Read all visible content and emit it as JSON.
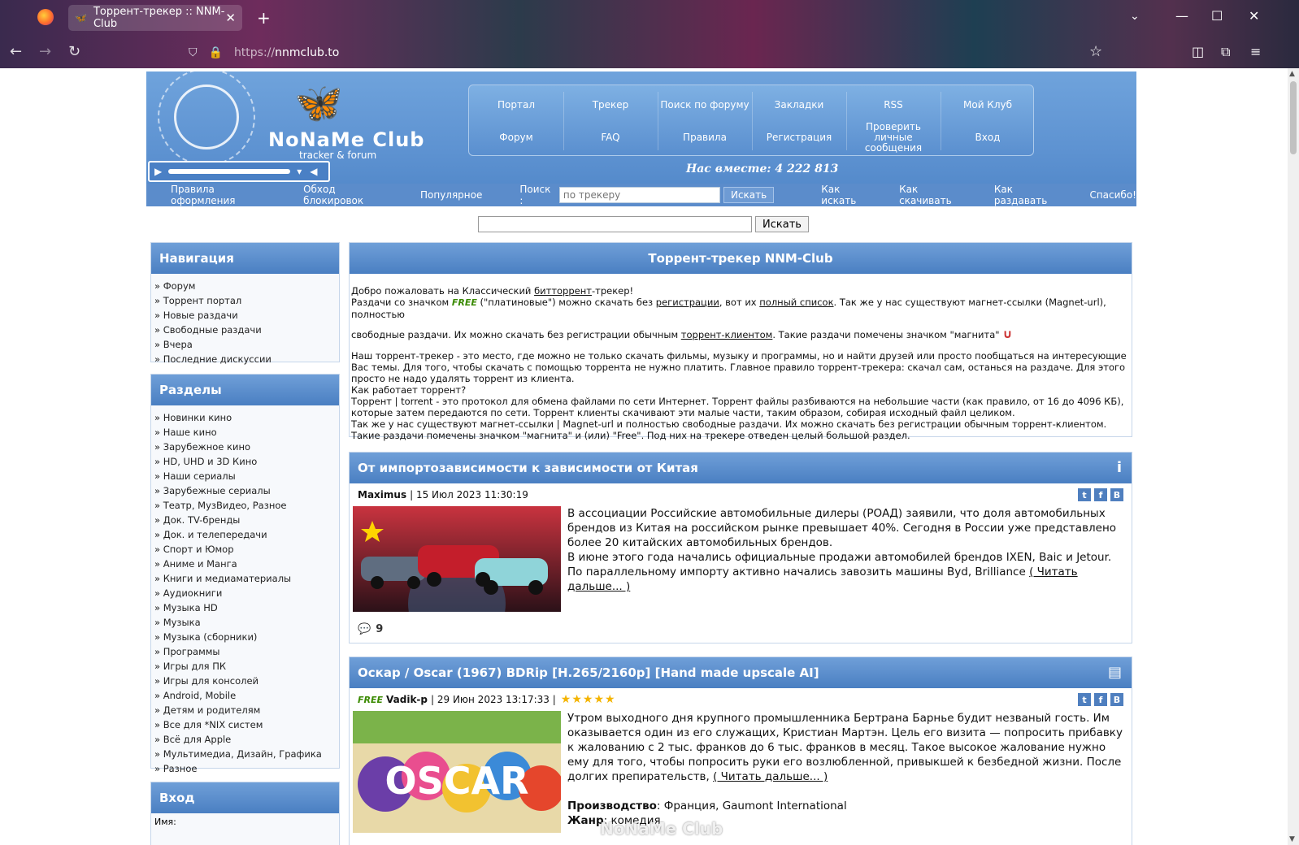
{
  "browser": {
    "tab_title": "Торрент-трекер :: NNM-Club",
    "url_scheme": "https://",
    "url_host": "nnmclub.to"
  },
  "header": {
    "logo_title": "NoNaMe Club",
    "logo_sub": "tracker & forum",
    "together": "Нас вместе: 4 222 813",
    "menu": [
      "Портал",
      "Трекер",
      "Поиск по форуму",
      "Закладки",
      "RSS",
      "Мой Клуб",
      "Форум",
      "FAQ",
      "Правила",
      "Регистрация",
      "Проверить личные сообщения",
      "Вход"
    ]
  },
  "subbar": {
    "left_links": [
      "Правила оформления",
      "Обход блокировок",
      "Популярное"
    ],
    "search_label": "Поиск :",
    "search_placeholder": "по трекеру",
    "search_button": "Искать",
    "right_links": [
      "Как искать",
      "Как скачивать",
      "Как раздавать",
      "Спасибо!"
    ]
  },
  "global_search": {
    "button": "Искать"
  },
  "sidebar": {
    "nav": {
      "title": "Навигация",
      "items": [
        "Форум",
        "Торрент портал",
        "Новые раздачи",
        "Свободные раздачи",
        "Вчера",
        "Последние дискуссии"
      ]
    },
    "sections": {
      "title": "Разделы",
      "items": [
        "Новинки кино",
        "Наше кино",
        "Зарубежное кино",
        "HD, UHD и 3D Кино",
        "Наши сериалы",
        "Зарубежные сериалы",
        "Театр, МузВидео, Разное",
        "Док. TV-бренды",
        "Док. и телепередачи",
        "Спорт и Юмор",
        "Аниме и Манга",
        "Книги и медиаматериалы",
        "Аудиокниги",
        "Музыка HD",
        "Музыка",
        "Музыка (сборники)",
        "Программы",
        "Игры для ПК",
        "Игры для консолей",
        "Android, Mobile",
        "Детям и родителям",
        "Все для *NIX систем",
        "Всё для Apple",
        "Мультимедиа, Дизайн, Графика",
        "Разное"
      ]
    },
    "login": {
      "title": "Вход",
      "name_label": "Имя:"
    }
  },
  "welcome": {
    "title": "Торрент-трекер NNM-Club",
    "l1a": "Добро пожаловать на Классический ",
    "l1b": "битторрент",
    "l1c": "-трекер!",
    "l2a": "Раздачи со значком ",
    "free": "FREE",
    "l2b": " (\"платиновые\") можно скачать без ",
    "l2c": "регистрации",
    "l2d": ", вот их ",
    "l2e": "полный список",
    "l2f": ". Так же у нас существуют магнет-ссылки (Magnet-url), полностью",
    "l3a": "свободные раздачи. Их можно скачать без регистрации обычным ",
    "l3b": "торрент-клиентом",
    "l3c": ". Такие раздачи помечены значком \"магнита\"",
    "p2": "Наш торрент-трекер - это место, где можно не только скачать фильмы, музыку и программы, но и найти друзей или просто пообщаться на интересующие Вас темы. Для того, чтобы скачать с помощью торрента не нужно платить. Главное правило торрент-трекера: скачал сам, останься на раздаче. Для этого просто не надо удалять торрент из клиента.",
    "p3": "Как работает торрент?",
    "p4": "Торрент | torrent - это протокол для обмена файлами по сети Интернет. Торрент файлы разбиваются на небольшие части (как правило, от 16 до 4096 КБ), которые затем передаются по сети. Торрент клиенты скачивают эти малые части, таким образом, собирая исходный файл целиком.",
    "p5": "Так же у нас существуют магнет-ссылки | Magnet-url и полностью свободные раздачи. Их можно скачать без регистрации обычным торрент-клиентом. Такие раздачи помечены значком \"магнита\" и (или) \"Free\". Под них на трекере отведен целый большой раздел."
  },
  "news1": {
    "title": "От импортозависимости к зависимости от Китая",
    "author": "Maximus",
    "date": "| 15 Июл 2023 11:30:19",
    "p1": "В ассоциации Российские автомобильные дилеры (РОАД) заявили, что доля автомобильных брендов из Китая на российском рынке превышает 40%. Сегодня в России уже представлено более 20 китайских автомобильных брендов.",
    "p2": "В июне этого года начались официальные продажи автомобилей брендов IXEN, Baic и Jetour. По параллельному импорту активно начались завозить машины Byd, Brilliance ",
    "more": "( Читать дальше... )",
    "comments": "9"
  },
  "news2": {
    "title": "Оскар / Oscar (1967) BDRip [H.265/2160p] [Hand made upscale AI]",
    "free": "FREE",
    "author": "Vadik-p",
    "date": "| 29 Июн 2023 13:17:33 |",
    "stars": "★★★★★",
    "p1": "Утром выходного дня крупного промышленника Бертрана Барнье будит незваный гость. Им оказывается один из его служащих, Кристиан Мартэн. Цель его визита — попросить прибавку к жалованию с 2 тыс. франков до 6 тыс. франков в месяц. Такое высокое жалование нужно ему для того, чтобы попросить руки его возлюбленной, привыкшей к безбедной жизни. После долгих препирательств, ",
    "more": "( Читать дальше... )",
    "prod_label": "Производство",
    "prod_value": ": Франция, Gaumont International",
    "genre_label": "Жанр",
    "genre_value": ": комедия",
    "poster_text": "OSCAR"
  },
  "watermark": "NoNaMe Club"
}
